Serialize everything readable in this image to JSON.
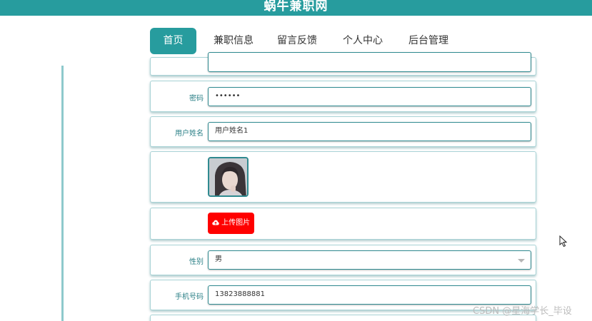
{
  "header": {
    "site_title": "蜗牛兼职网"
  },
  "nav": {
    "items": [
      {
        "label": "首页",
        "active": true
      },
      {
        "label": "兼职信息",
        "active": false
      },
      {
        "label": "留言反馈",
        "active": false
      },
      {
        "label": "个人中心",
        "active": false
      },
      {
        "label": "后台管理",
        "active": false
      }
    ]
  },
  "form": {
    "password": {
      "label": "密码",
      "value": "••••••"
    },
    "user_name": {
      "label": "用户姓名",
      "value": "用户姓名1"
    },
    "avatar": {
      "alt": "avatar"
    },
    "upload": {
      "icon": "cloud-upload-icon",
      "label": "上传图片"
    },
    "gender": {
      "label": "性别",
      "value": "男"
    },
    "phone": {
      "label": "手机号码",
      "value": "13823888881"
    }
  },
  "watermark": "CSDN @星海学长_毕设",
  "colors": {
    "primary": "#279c9e",
    "upload_button": "#ff0000",
    "label_text": "#2a7f86"
  }
}
